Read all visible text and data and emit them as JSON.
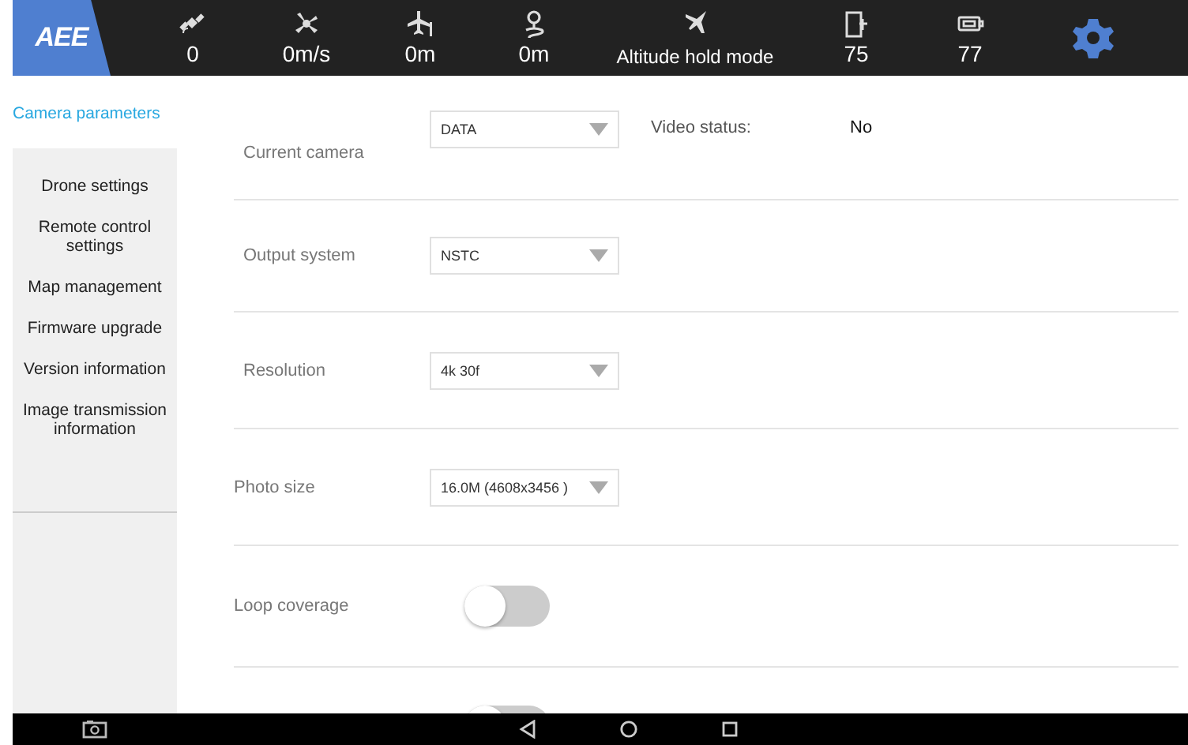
{
  "top_bar": {
    "logo": "AEE",
    "stats": [
      {
        "kind": "satellite",
        "value": "0"
      },
      {
        "kind": "speed",
        "value": "0m/s"
      },
      {
        "kind": "height",
        "value": "0m"
      },
      {
        "kind": "distance",
        "value": "0m"
      },
      {
        "kind": "mode",
        "value": "Altitude hold mode"
      },
      {
        "kind": "drone-battery",
        "value": "75"
      },
      {
        "kind": "remote-battery",
        "value": "77"
      }
    ]
  },
  "sidebar": {
    "items": [
      {
        "label": "Camera parameters",
        "selected": true
      },
      {
        "label": "Drone settings",
        "selected": false
      },
      {
        "label": "Remote control settings",
        "selected": false
      },
      {
        "label": "Map management",
        "selected": false
      },
      {
        "label": "Firmware upgrade",
        "selected": false
      },
      {
        "label": "Version information",
        "selected": false
      },
      {
        "label": "Image transmission information",
        "selected": false
      }
    ]
  },
  "settings": [
    {
      "kind": "select",
      "label": "Current camera",
      "value": "DATA",
      "status_label": "Video status:",
      "status_value": "No"
    },
    {
      "kind": "select",
      "label": "Output system",
      "value": "NSTC"
    },
    {
      "kind": "select",
      "label": "Resolution",
      "value": "4k 30f"
    },
    {
      "kind": "select",
      "label": "Photo size",
      "value": "16.0M (4608x3456 )"
    },
    {
      "kind": "toggle",
      "label": "Loop coverage",
      "on": false
    },
    {
      "kind": "toggle",
      "on": false
    }
  ]
}
